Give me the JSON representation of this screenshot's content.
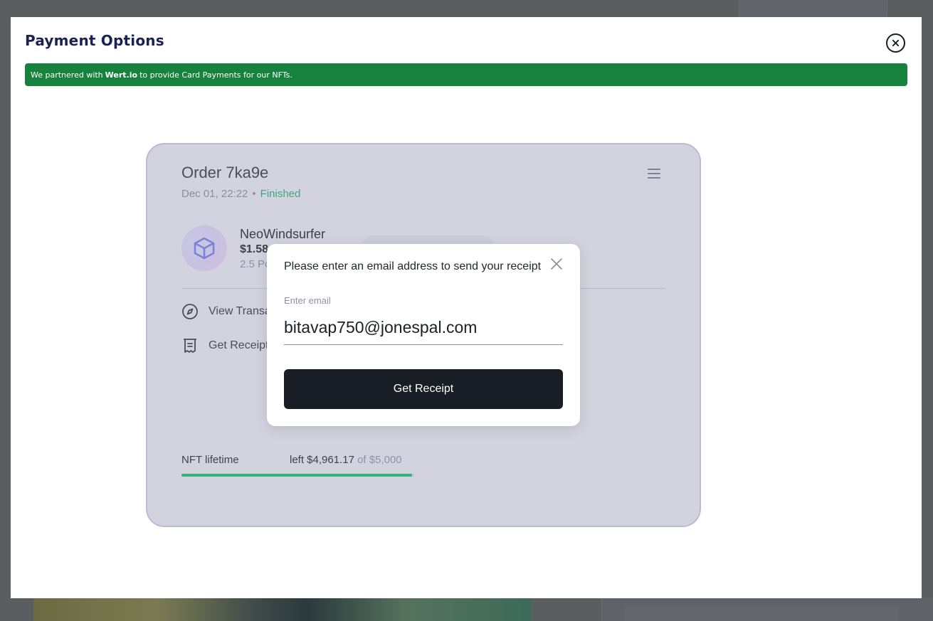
{
  "modal": {
    "title": "Payment Options",
    "banner": {
      "prefix": "We partnered with",
      "partner": "Wert.io",
      "suffix": "to provide Card Payments for our NFTs."
    }
  },
  "order": {
    "title": "Order 7ka9e",
    "date": "Dec 01, 22:22",
    "separator": "•",
    "status": "Finished",
    "status_color": "#3fa97a"
  },
  "nft": {
    "name": "NeoWindsurfer",
    "price": "$1.58",
    "sub": "2.5 Po",
    "icon": "cube-icon"
  },
  "actions": {
    "view_transaction": "View Transa",
    "get_receipt": "Get Receipt"
  },
  "lifetime": {
    "label": "NFT lifetime",
    "left": "left $4,961.17",
    "of": "of $5,000",
    "progress_fraction": 0.992
  },
  "receipt_dialog": {
    "title": "Please enter an email address to send your receipt",
    "field_label": "Enter email",
    "email_value": "bitavap750@jonespal.com",
    "button_label": "Get Receipt"
  }
}
